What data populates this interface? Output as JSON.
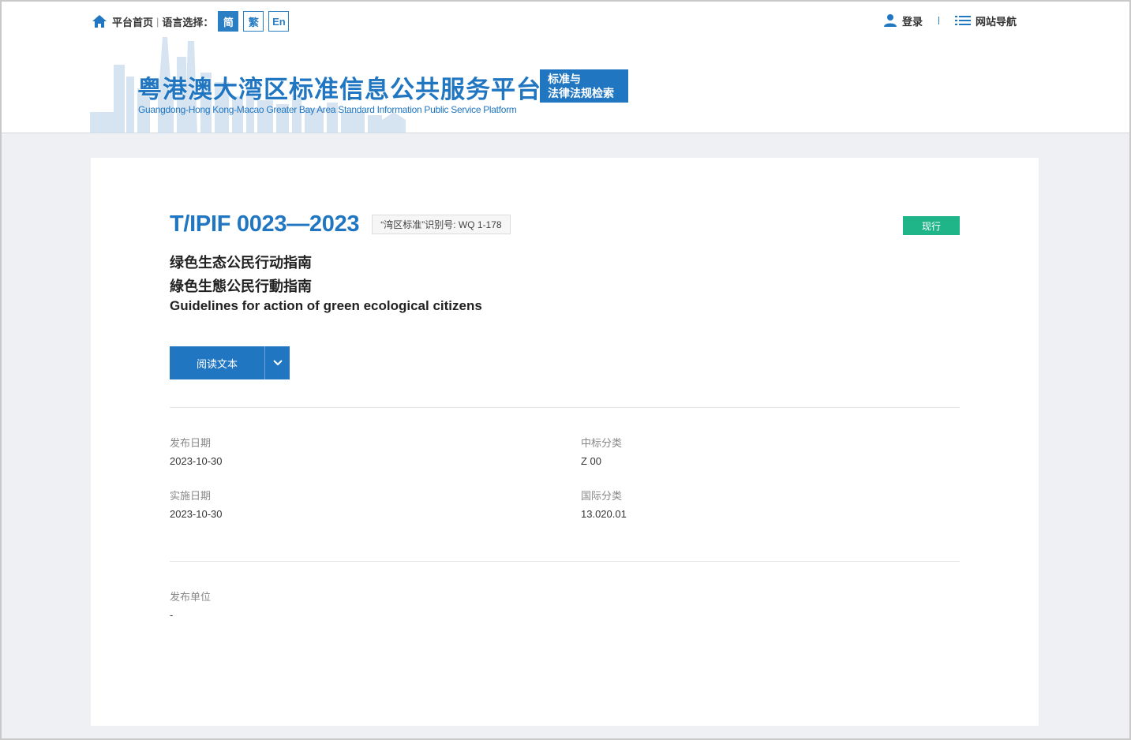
{
  "header": {
    "home_label": "平台首页",
    "lang_prompt": "语言选择：",
    "lang_options": [
      "简",
      "繁",
      "En"
    ],
    "login_label": "登录",
    "nav_label": "网站导航",
    "site_title": "粤港澳大湾区标准信息公共服务平台",
    "site_subtitle": "Guangdong-Hong Kong-Macao Greater Bay Area Standard Information Public Service Platform",
    "tag_line1": "标准与",
    "tag_line2": "法律法规检索"
  },
  "standard": {
    "code": "T/IPIF 0023—2023",
    "gba_id": "“湾区标准”识别号: WQ 1-178",
    "status": "现行",
    "title_cn": "绿色生态公民行动指南",
    "title_tw": "綠色生態公民行動指南",
    "title_en": "Guidelines for action of green ecological citizens",
    "read_button": "阅读文本"
  },
  "details": {
    "publish_date_label": "发布日期",
    "publish_date": "2023-10-30",
    "impl_date_label": "实施日期",
    "impl_date": "2023-10-30",
    "ccs_label": "中标分类",
    "ccs": "Z 00",
    "ics_label": "国际分类",
    "ics": "13.020.01",
    "publisher_label": "发布单位",
    "publisher": "-"
  },
  "colors": {
    "brand": "#2176c1",
    "status_green": "#1fb589"
  }
}
